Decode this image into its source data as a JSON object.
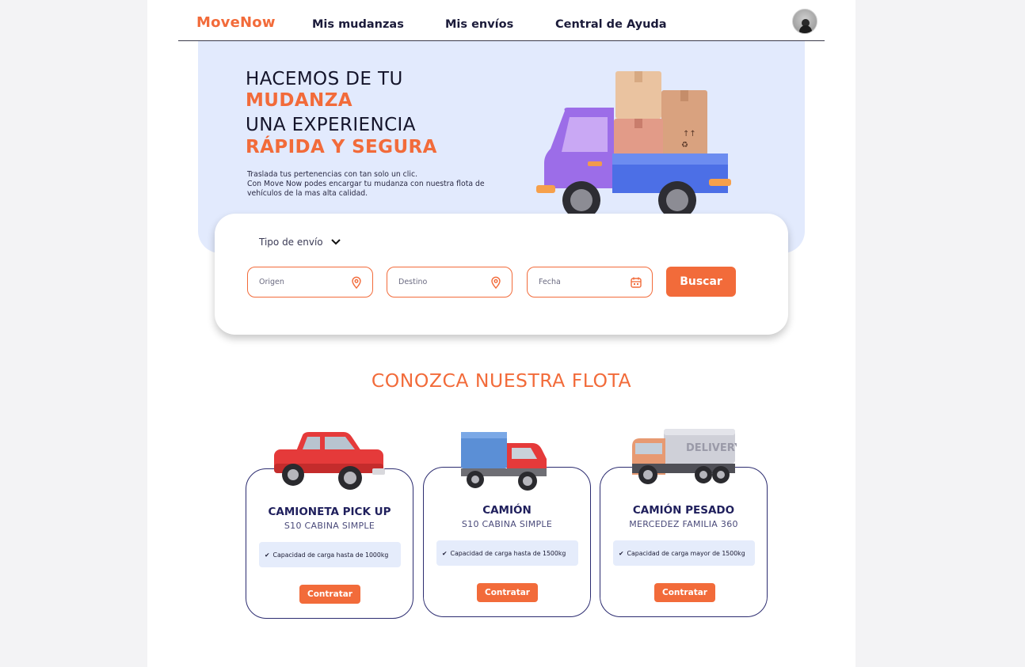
{
  "header": {
    "logo": "MoveNow",
    "nav": [
      "Mis mudanzas",
      "Mis envíos",
      "Central de Ayuda"
    ]
  },
  "hero": {
    "line1": "HACEMOS DE TU",
    "line2": "MUDANZA",
    "line3": "UNA EXPERIENCIA",
    "line4": "RÁPIDA Y SEGURA",
    "desc1": "Traslada tus pertenencias con tan solo un clic.",
    "desc2": "Con Move Now podes encargar tu mudanza con nuestra flota de vehículos de la mas alta calidad."
  },
  "search": {
    "ship_type": "Tipo de envío",
    "origin": "Origen",
    "destination": "Destino",
    "date": "Fecha",
    "button": "Buscar"
  },
  "fleet": {
    "title": "CONOZCA NUESTRA FLOTA",
    "vehicles": [
      {
        "name": "CAMIONETA PICK UP",
        "model": "S10 CABINA SIMPLE",
        "capacity": "Capacidad de carga hasta de 1000kg",
        "button": "Contratar"
      },
      {
        "name": "CAMIÓN",
        "model": "S10 CABINA SIMPLE",
        "capacity": "Capacidad de carga hasta de 1500kg",
        "button": "Contratar"
      },
      {
        "name": "CAMIÓN PESADO",
        "model": "MERCEDEZ FAMILIA 360",
        "capacity": "Capacidad de carga mayor de 1500kg",
        "button": "Contratar"
      }
    ],
    "delivery_text": "DELIVERY"
  },
  "colors": {
    "accent": "#f26b3a",
    "navy": "#1f1f5c",
    "hero_bg": "#e2eafd"
  }
}
